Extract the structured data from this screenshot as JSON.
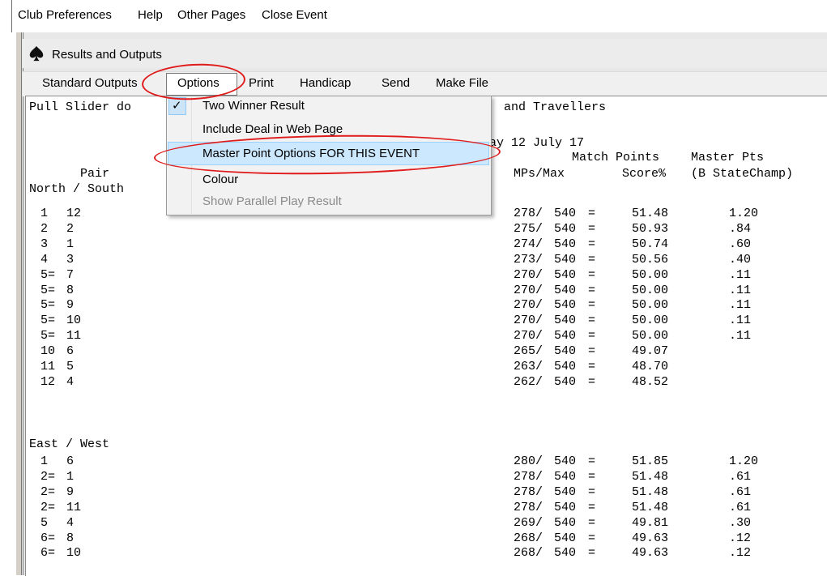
{
  "app_menu": {
    "items": [
      "Club Preferences",
      "Help",
      "Other Pages",
      "Close Event"
    ]
  },
  "window": {
    "title": "Results and Outputs",
    "icon": "spade-icon"
  },
  "menubar": {
    "items": [
      "Standard Outputs",
      "Options",
      "Print",
      "Handicap",
      "Send",
      "Make File"
    ]
  },
  "dropdown": {
    "items": [
      {
        "label": "Two Winner Result",
        "checked": true,
        "enabled": true
      },
      {
        "label": "Include Deal in Web Page",
        "checked": false,
        "enabled": true
      },
      {
        "label": "Master Point Options FOR THIS EVENT",
        "checked": false,
        "enabled": true,
        "highlighted": true
      },
      {
        "label": "Colour",
        "checked": false,
        "enabled": true
      },
      {
        "label": "Show Parallel Play Result",
        "checked": false,
        "enabled": false
      }
    ]
  },
  "report": {
    "line1_left": "Pull Slider do",
    "line1_right": "and Travellers",
    "date_fragment": "ay 12 July 17",
    "hdr_match_points": "Match Points",
    "hdr_master_pts": "Master Pts",
    "hdr_pair": "Pair",
    "hdr_mps_max": "MPs/Max",
    "hdr_score": "Score%",
    "hdr_category": "(B StateChamp)",
    "ns_section": "North / South",
    "ew_section": "East / West",
    "ns_rows": [
      {
        "place": "1",
        "pair": "12",
        "mps": "278/",
        "max": "540",
        "score": "51.48",
        "mp": "1.20"
      },
      {
        "place": "2",
        "pair": "2",
        "mps": "275/",
        "max": "540",
        "score": "50.93",
        "mp": ".84"
      },
      {
        "place": "3",
        "pair": "1",
        "mps": "274/",
        "max": "540",
        "score": "50.74",
        "mp": ".60"
      },
      {
        "place": "4",
        "pair": "3",
        "mps": "273/",
        "max": "540",
        "score": "50.56",
        "mp": ".40"
      },
      {
        "place": "5=",
        "pair": "7",
        "mps": "270/",
        "max": "540",
        "score": "50.00",
        "mp": ".11"
      },
      {
        "place": "5=",
        "pair": "8",
        "mps": "270/",
        "max": "540",
        "score": "50.00",
        "mp": ".11"
      },
      {
        "place": "5=",
        "pair": "9",
        "mps": "270/",
        "max": "540",
        "score": "50.00",
        "mp": ".11"
      },
      {
        "place": "5=",
        "pair": "10",
        "mps": "270/",
        "max": "540",
        "score": "50.00",
        "mp": ".11"
      },
      {
        "place": "5=",
        "pair": "11",
        "mps": "270/",
        "max": "540",
        "score": "50.00",
        "mp": ".11"
      },
      {
        "place": "10",
        "pair": "6",
        "mps": "265/",
        "max": "540",
        "score": "49.07",
        "mp": ""
      },
      {
        "place": "11",
        "pair": "5",
        "mps": "263/",
        "max": "540",
        "score": "48.70",
        "mp": ""
      },
      {
        "place": "12",
        "pair": "4",
        "mps": "262/",
        "max": "540",
        "score": "48.52",
        "mp": ""
      }
    ],
    "ew_rows": [
      {
        "place": "1",
        "pair": "6",
        "mps": "280/",
        "max": "540",
        "score": "51.85",
        "mp": "1.20"
      },
      {
        "place": "2=",
        "pair": "1",
        "mps": "278/",
        "max": "540",
        "score": "51.48",
        "mp": ".61"
      },
      {
        "place": "2=",
        "pair": "9",
        "mps": "278/",
        "max": "540",
        "score": "51.48",
        "mp": ".61"
      },
      {
        "place": "2=",
        "pair": "11",
        "mps": "278/",
        "max": "540",
        "score": "51.48",
        "mp": ".61"
      },
      {
        "place": "5",
        "pair": "4",
        "mps": "269/",
        "max": "540",
        "score": "49.81",
        "mp": ".30"
      },
      {
        "place": "6=",
        "pair": "8",
        "mps": "268/",
        "max": "540",
        "score": "49.63",
        "mp": ".12"
      },
      {
        "place": "6=",
        "pair": "10",
        "mps": "268/",
        "max": "540",
        "score": "49.63",
        "mp": ".12"
      }
    ]
  },
  "colors": {
    "annotation": "#e01b1b",
    "highlight": "#cce8ff",
    "disabled_text": "#8a8a8a"
  }
}
